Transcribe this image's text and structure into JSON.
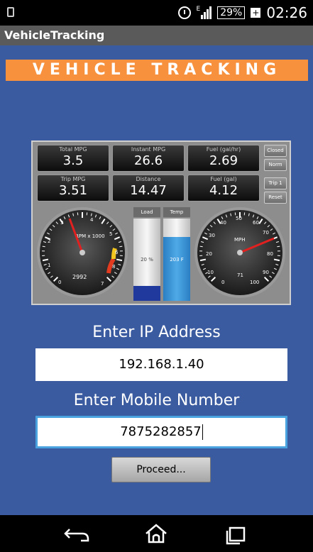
{
  "status_bar": {
    "time": "02:26",
    "battery": "29%",
    "network_label": "E"
  },
  "app_title": "VehicleTracking",
  "banner": "VEHICLE TRACKING",
  "dashboard": {
    "cells": [
      {
        "label": "Total MPG",
        "value": "3.5"
      },
      {
        "label": "Instant MPG",
        "value": "26.6"
      },
      {
        "label": "Fuel (gal/hr)",
        "value": "2.69"
      },
      {
        "label": "Trip MPG",
        "value": "3.51"
      },
      {
        "label": "Distance",
        "value": "14.47"
      },
      {
        "label": "Fuel (gal)",
        "value": "4.12"
      }
    ],
    "side_buttons": [
      "Closed",
      "Norm",
      "Trip 1",
      "Reset"
    ],
    "rpm_gauge": {
      "label": "RPM x 1000",
      "reading": "2992",
      "ticks": [
        "0",
        "1",
        "2",
        "3",
        "4",
        "5",
        "6",
        "7",
        "8"
      ]
    },
    "mph_gauge": {
      "label": "MPH",
      "reading": "71",
      "ticks": [
        "0",
        "10",
        "20",
        "30",
        "40",
        "50",
        "60",
        "70",
        "80",
        "90",
        "100"
      ]
    },
    "load": {
      "label": "Load",
      "value": "20 %",
      "fill_fraction": 0.18
    },
    "temp": {
      "label": "Temp",
      "value": "203 F",
      "fill_fraction": 0.78
    }
  },
  "ip_label": "Enter IP Address",
  "ip_value": "192.168.1.40",
  "mobile_label": "Enter Mobile Number",
  "mobile_value": "7875282857",
  "proceed_label": "Proceed...",
  "colors": {
    "banner": "#f7913d",
    "background": "#3b5ba0",
    "focus": "#4aa3df"
  }
}
